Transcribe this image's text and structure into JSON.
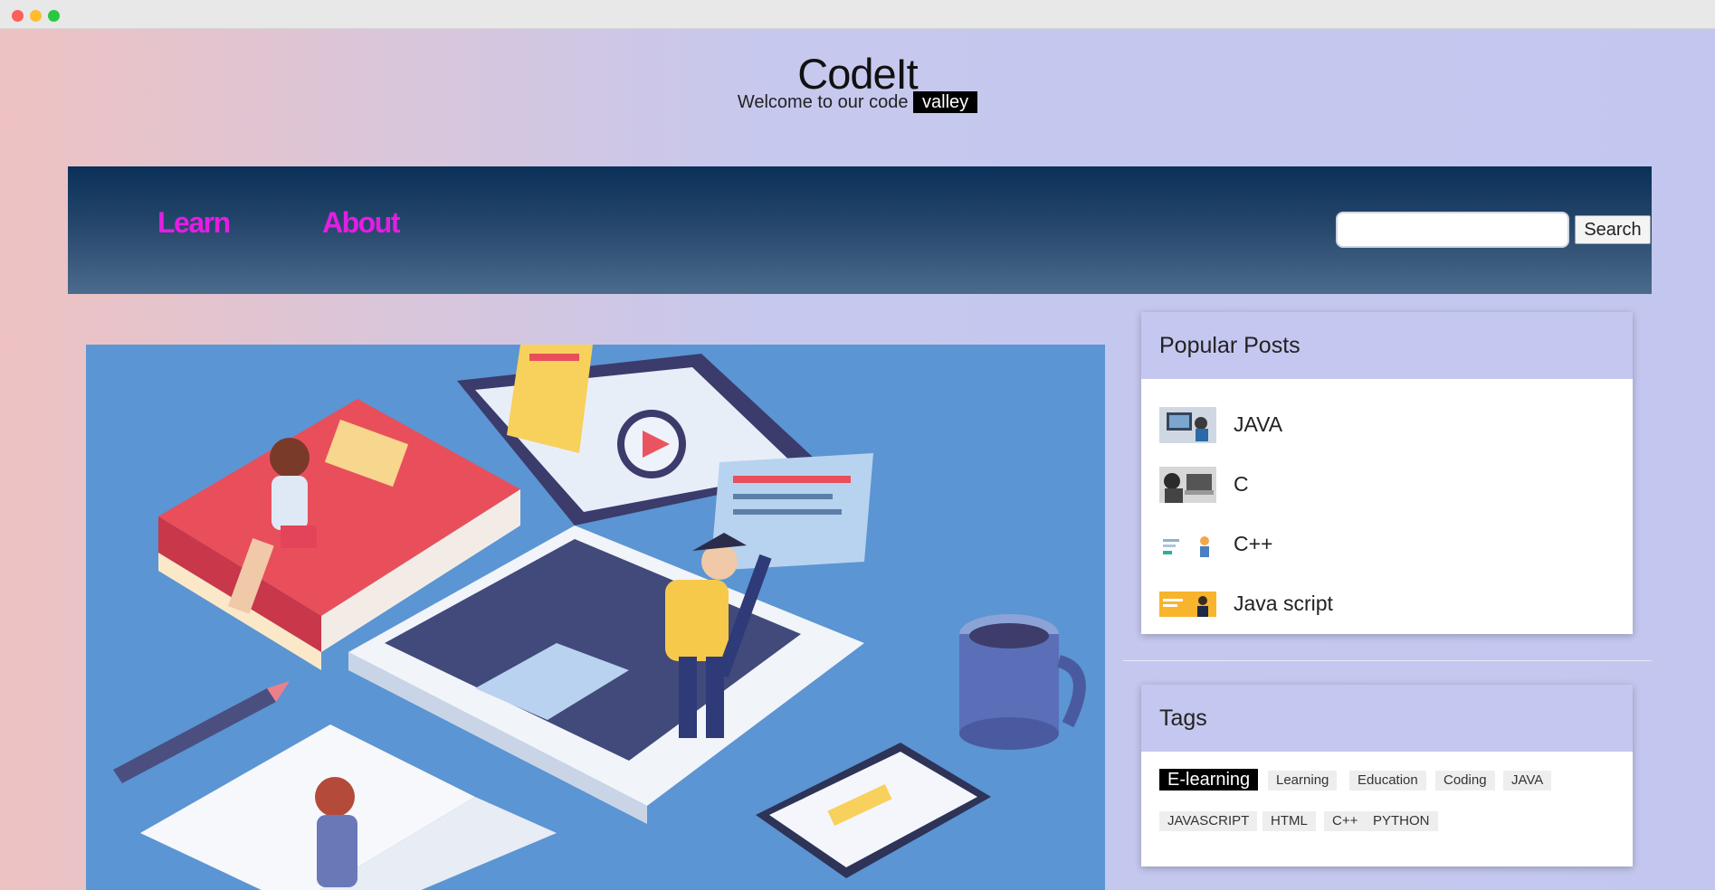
{
  "site": {
    "title": "CodeIt",
    "tagline_prefix": "Welcome to our code",
    "tagline_highlight": "valley"
  },
  "nav": {
    "links": [
      "Learn",
      "About"
    ],
    "search_value": "",
    "search_button": "Search"
  },
  "popular_posts": {
    "heading": "Popular Posts",
    "items": [
      "JAVA",
      "C",
      "C++",
      "Java script"
    ]
  },
  "tags": {
    "heading": "Tags",
    "items": [
      "E-learning",
      "Learning",
      "Education",
      "Coding",
      "JAVA",
      "JAVASCRIPT",
      "HTML",
      "C++",
      "PYTHON"
    ],
    "active": "E-learning"
  },
  "colors": {
    "nav_link": "#e31ee3",
    "nav_bg_top": "#0b3058",
    "card_head": "#c4c7ef"
  }
}
